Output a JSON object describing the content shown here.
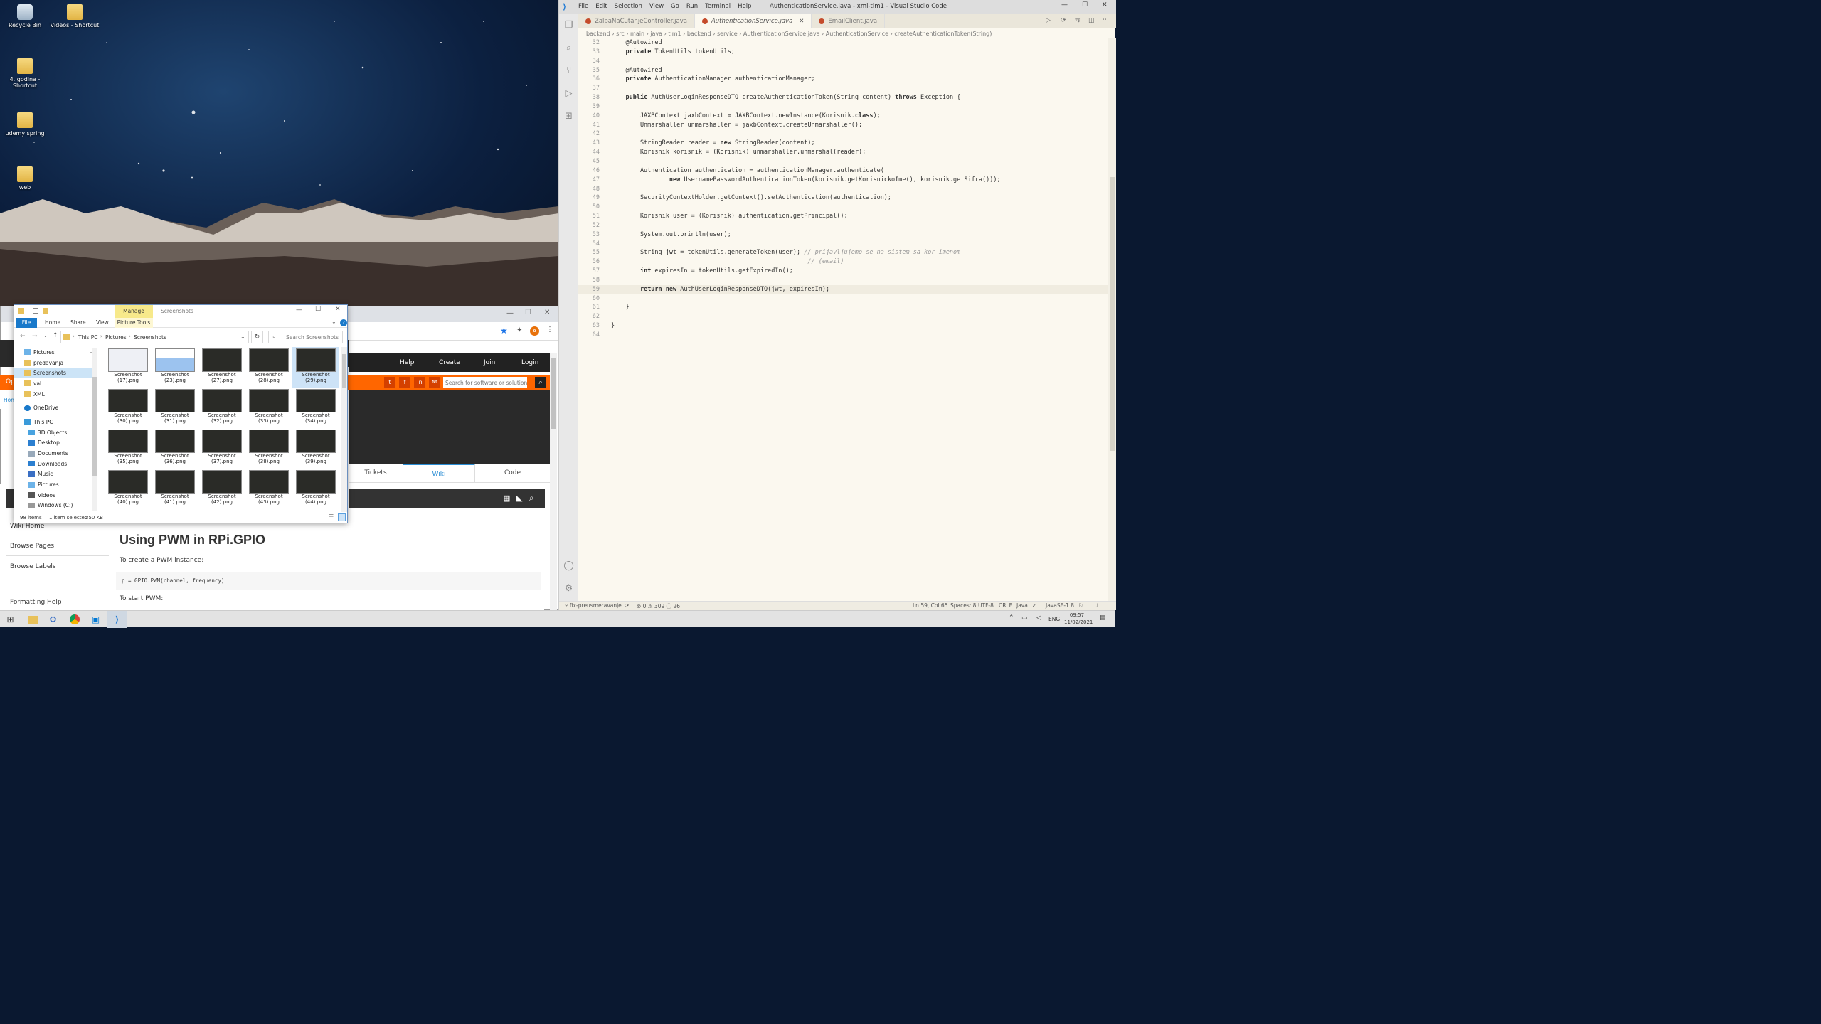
{
  "desktop": {
    "icons": [
      {
        "label": "Recycle Bin",
        "kind": "bin"
      },
      {
        "label": "Videos - Shortcut",
        "kind": "folder"
      },
      {
        "label": "4. godina - Shortcut",
        "kind": "folder"
      },
      {
        "label": "udemy spring",
        "kind": "folder"
      },
      {
        "label": "web",
        "kind": "folder"
      }
    ]
  },
  "vscode": {
    "menu": [
      "File",
      "Edit",
      "Selection",
      "View",
      "Go",
      "Run",
      "Terminal",
      "Help"
    ],
    "title": "AuthenticationService.java - xml-tim1 - Visual Studio Code",
    "tabs": [
      "ZalbaNaCutanjeController.java",
      "AuthenticationService.java",
      "EmailClient.java"
    ],
    "breadcrumb": "backend › src › main › java › tim1 › backend › service › AuthenticationService.java › AuthenticationService › createAuthenticationToken(String)",
    "lines": [
      {
        "n": "32",
        "t": "    @Autowired"
      },
      {
        "n": "33",
        "t": "    private TokenUtils tokenUtils;"
      },
      {
        "n": "34",
        "t": ""
      },
      {
        "n": "35",
        "t": "    @Autowired"
      },
      {
        "n": "36",
        "t": "    private AuthenticationManager authenticationManager;"
      },
      {
        "n": "37",
        "t": ""
      },
      {
        "n": "38",
        "t": "    public AuthUserLoginResponseDTO createAuthenticationToken(String content) throws Exception {"
      },
      {
        "n": "39",
        "t": ""
      },
      {
        "n": "40",
        "t": "        JAXBContext jaxbContext = JAXBContext.newInstance(Korisnik.class);"
      },
      {
        "n": "41",
        "t": "        Unmarshaller unmarshaller = jaxbContext.createUnmarshaller();"
      },
      {
        "n": "42",
        "t": ""
      },
      {
        "n": "43",
        "t": "        StringReader reader = new StringReader(content);"
      },
      {
        "n": "44",
        "t": "        Korisnik korisnik = (Korisnik) unmarshaller.unmarshal(reader);"
      },
      {
        "n": "45",
        "t": ""
      },
      {
        "n": "46",
        "t": "        Authentication authentication = authenticationManager.authenticate("
      },
      {
        "n": "47",
        "t": "                new UsernamePasswordAuthenticationToken(korisnik.getKorisnickoIme(), korisnik.getSifra()));"
      },
      {
        "n": "48",
        "t": ""
      },
      {
        "n": "49",
        "t": "        SecurityContextHolder.getContext().setAuthentication(authentication);"
      },
      {
        "n": "50",
        "t": ""
      },
      {
        "n": "51",
        "t": "        Korisnik user = (Korisnik) authentication.getPrincipal();"
      },
      {
        "n": "52",
        "t": ""
      },
      {
        "n": "53",
        "t": "        System.out.println(user);"
      },
      {
        "n": "54",
        "t": ""
      },
      {
        "n": "55",
        "t": "        String jwt = tokenUtils.generateToken(user); // prijavljujemo se na sistem sa kor imenom"
      },
      {
        "n": "56",
        "t": "                                                      // (email)"
      },
      {
        "n": "57",
        "t": "        int expiresIn = tokenUtils.getExpiredIn();"
      },
      {
        "n": "58",
        "t": ""
      },
      {
        "n": "59",
        "t": "        return new AuthUserLoginResponseDTO(jwt, expiresIn);"
      },
      {
        "n": "60",
        "t": ""
      },
      {
        "n": "61",
        "t": "    }"
      },
      {
        "n": "62",
        "t": ""
      },
      {
        "n": "63",
        "t": "}"
      },
      {
        "n": "64",
        "t": ""
      }
    ],
    "current_line": "59",
    "status": {
      "branch": "fix-preusmeravanje",
      "problems": "⊗ 0 ⚠ 309 ⓘ 26",
      "position": "Ln 59, Col 65",
      "spaces": "Spaces: 8",
      "encoding": "UTF-8",
      "eol": "CRLF",
      "language": "Java",
      "jdk": "JavaSE-1.8"
    }
  },
  "browser": {
    "site_nav": [
      "Help",
      "Create",
      "Join",
      "Login"
    ],
    "search_placeholder": "Search for software or solutions",
    "tabs": [
      "Tickets",
      "Wiki",
      "Code"
    ],
    "left_links": [
      "Wiki Home",
      "Browse Pages",
      "Browse Labels",
      "Formatting Help"
    ],
    "heading": "Using PWM in RPi.GPIO",
    "p1": "To create a PWM instance:",
    "code1": "p = GPIO.PWM(channel, frequency)",
    "p2": "To start PWM:",
    "partial": {
      "left_tab": "Op",
      "left_crumb": "Hom"
    }
  },
  "explorer": {
    "manage_tab": "Manage",
    "title": "Screenshots",
    "ribbon": [
      "File",
      "Home",
      "Share",
      "View",
      "Picture Tools"
    ],
    "path": [
      "This PC",
      "Pictures",
      "Screenshots"
    ],
    "search_placeholder": "Search Screenshots",
    "nav": [
      "Pictures",
      "predavanja",
      "Screenshots",
      "val",
      "XML",
      "OneDrive",
      "This PC",
      "3D Objects",
      "Desktop",
      "Documents",
      "Downloads",
      "Music",
      "Pictures",
      "Videos",
      "Windows (C:)"
    ],
    "files": [
      "Screenshot (17).png",
      "Screenshot (23).png",
      "Screenshot (27).png",
      "Screenshot (28).png",
      "Screenshot (29).png",
      "Screenshot (30).png",
      "Screenshot (31).png",
      "Screenshot (32).png",
      "Screenshot (33).png",
      "Screenshot (34).png",
      "Screenshot (35).png",
      "Screenshot (36).png",
      "Screenshot (37).png",
      "Screenshot (38).png",
      "Screenshot (39).png",
      "Screenshot (40).png",
      "Screenshot (41).png",
      "Screenshot (42).png",
      "Screenshot (43).png",
      "Screenshot (44).png"
    ],
    "status_items": "98 items",
    "status_selected": "1 item selected",
    "status_size": "350 KB"
  },
  "taskbar": {
    "lang": "ENG",
    "time": "09:57",
    "date": "11/02/2021"
  }
}
